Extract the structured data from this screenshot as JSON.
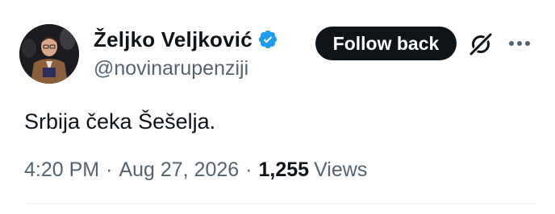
{
  "author": {
    "display_name": "Željko Veljković",
    "handle": "@novinarupenziji",
    "verified": true
  },
  "actions": {
    "follow_label": "Follow back"
  },
  "tweet": {
    "text": "Srbija čeka Šešelja.",
    "time": "4:20 PM",
    "date": "Aug 27, 2026",
    "views_count": "1,255",
    "views_label": "Views"
  },
  "icons": {
    "verified": "verified-badge-icon",
    "grok": "grok-icon",
    "more": "more-options-icon"
  },
  "colors": {
    "verified_blue": "#1d9bf0",
    "text_primary": "#0f1419",
    "text_secondary": "#536471",
    "button_bg": "#0f1419"
  }
}
